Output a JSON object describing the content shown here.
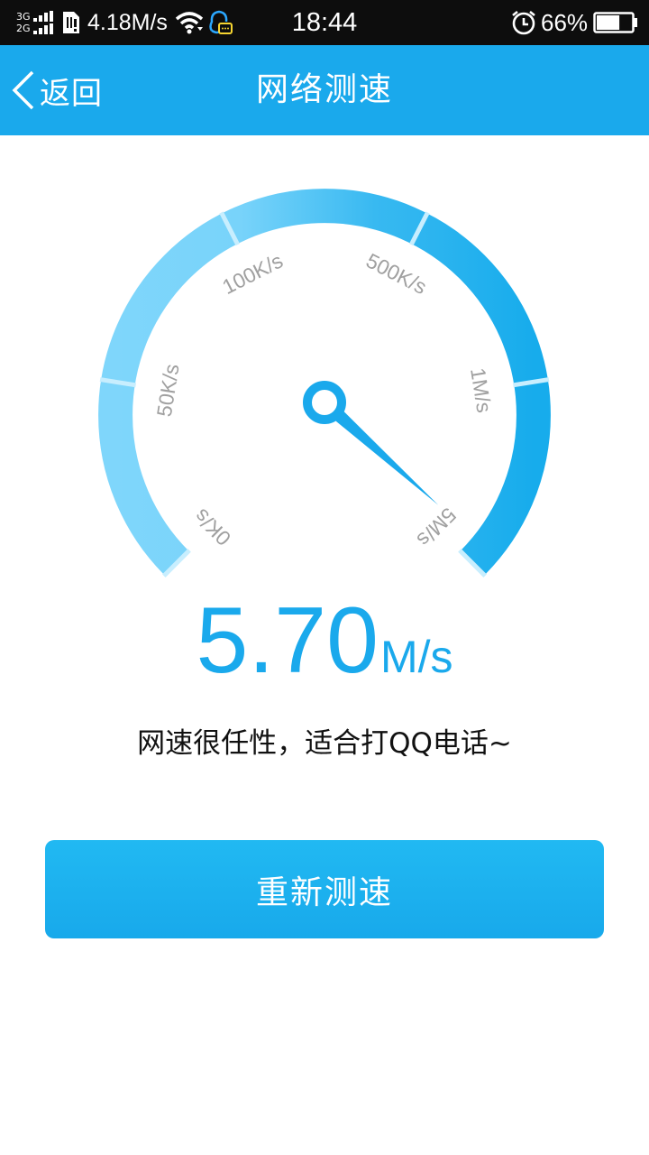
{
  "status_bar": {
    "network_top": "3G",
    "network_bottom": "2G",
    "net_speed": "4.18M/s",
    "time": "18:44",
    "battery_percent": "66%",
    "battery_level": 0.66,
    "icons": [
      "signal-icon",
      "sim-alert-icon",
      "wifi-icon",
      "qq-icon",
      "alarm-icon",
      "battery-icon"
    ]
  },
  "header": {
    "back_label": "返回",
    "title": "网络测速"
  },
  "gauge": {
    "ticks": [
      {
        "label": "0K/s",
        "angle": -135
      },
      {
        "label": "50K/s",
        "angle": -81
      },
      {
        "label": "100K/s",
        "angle": -27
      },
      {
        "label": "500K/s",
        "angle": 27
      },
      {
        "label": "1M/s",
        "angle": 81
      },
      {
        "label": "5M/s",
        "angle": 135
      }
    ],
    "needle_angle": 132,
    "colors": {
      "light": "#7fd6fb",
      "mid": "#4cc1f3",
      "dark": "#1aaeec",
      "needle": "#1aa9ec"
    }
  },
  "result": {
    "value": "5.70",
    "unit": "M/s",
    "comment": "网速很任性，适合打QQ电话~"
  },
  "actions": {
    "retest_label": "重新测速"
  }
}
